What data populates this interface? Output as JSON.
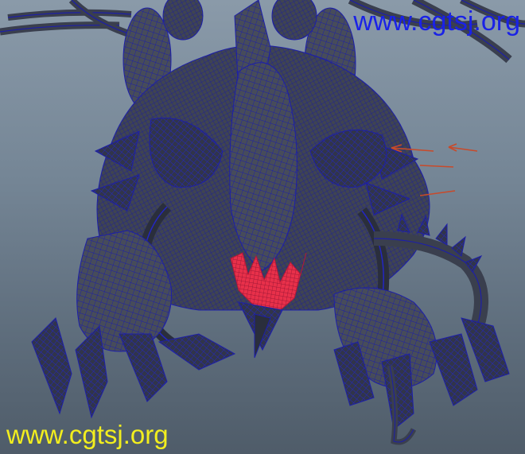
{
  "viewport": {
    "subject": "wireframe-creature-model",
    "colors": {
      "background_top": "#8a9aa9",
      "background_bottom": "#4f5c69",
      "surface": "#4a4f5c",
      "surface_dark": "#2f3340",
      "wireframe": "#1d1fa8",
      "mouth": "#e8304a",
      "motion_marks": "#c84a2a"
    }
  },
  "watermarks": {
    "top_right": {
      "text": "www.cgtsj.org",
      "color": "#1a22e6"
    },
    "bottom_left": {
      "text": "www.cgtsj.org",
      "color": "#f2ee1e"
    }
  }
}
